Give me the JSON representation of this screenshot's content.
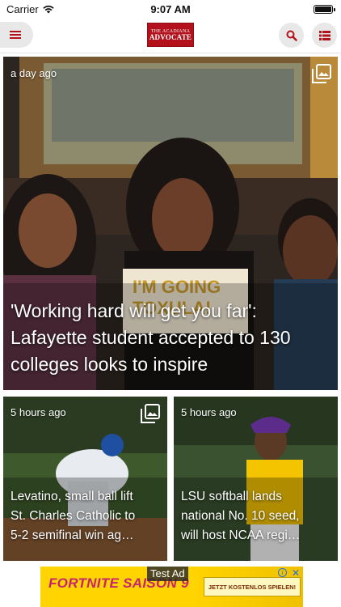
{
  "status_bar": {
    "carrier": "Carrier",
    "time": "9:07 AM",
    "wifi_icon": "wifi-icon",
    "battery_icon": "battery-icon",
    "battery_level": 1.0
  },
  "header": {
    "menu_icon": "hamburger-menu-icon",
    "logo": {
      "line1": "THE ACADIANA",
      "line2": "ADVOCATE"
    },
    "search_icon": "search-icon",
    "sections_icon": "sections-list-icon",
    "accent_color": "#b3121c"
  },
  "feed": {
    "hero": {
      "time_ago": "a day ago",
      "headline": "'Working hard will get you far': Lafayette student accepted to 130 colleges looks to inspire",
      "gallery_icon": "photo-gallery-icon"
    },
    "cards": [
      {
        "time_ago": "5 hours ago",
        "headline_lines": [
          "Levatino, small ball lift",
          "St. Charles Catholic to",
          "5-2 semifinal win ag…"
        ],
        "gallery_icon": "photo-gallery-icon"
      },
      {
        "time_ago": "5 hours ago",
        "headline_lines": [
          "LSU softball lands",
          "national No. 10 seed,",
          "will host NCAA regi…"
        ],
        "gallery_icon": ""
      }
    ]
  },
  "ad": {
    "label": "Test Ad",
    "brand_text": "FORTNITE SAISON 9",
    "cta": "JETZT KOSTENLOS SPIELEN!",
    "info_icon": "ad-info-icon",
    "close_icon": "ad-close-icon",
    "background_color": "#ffd400"
  }
}
